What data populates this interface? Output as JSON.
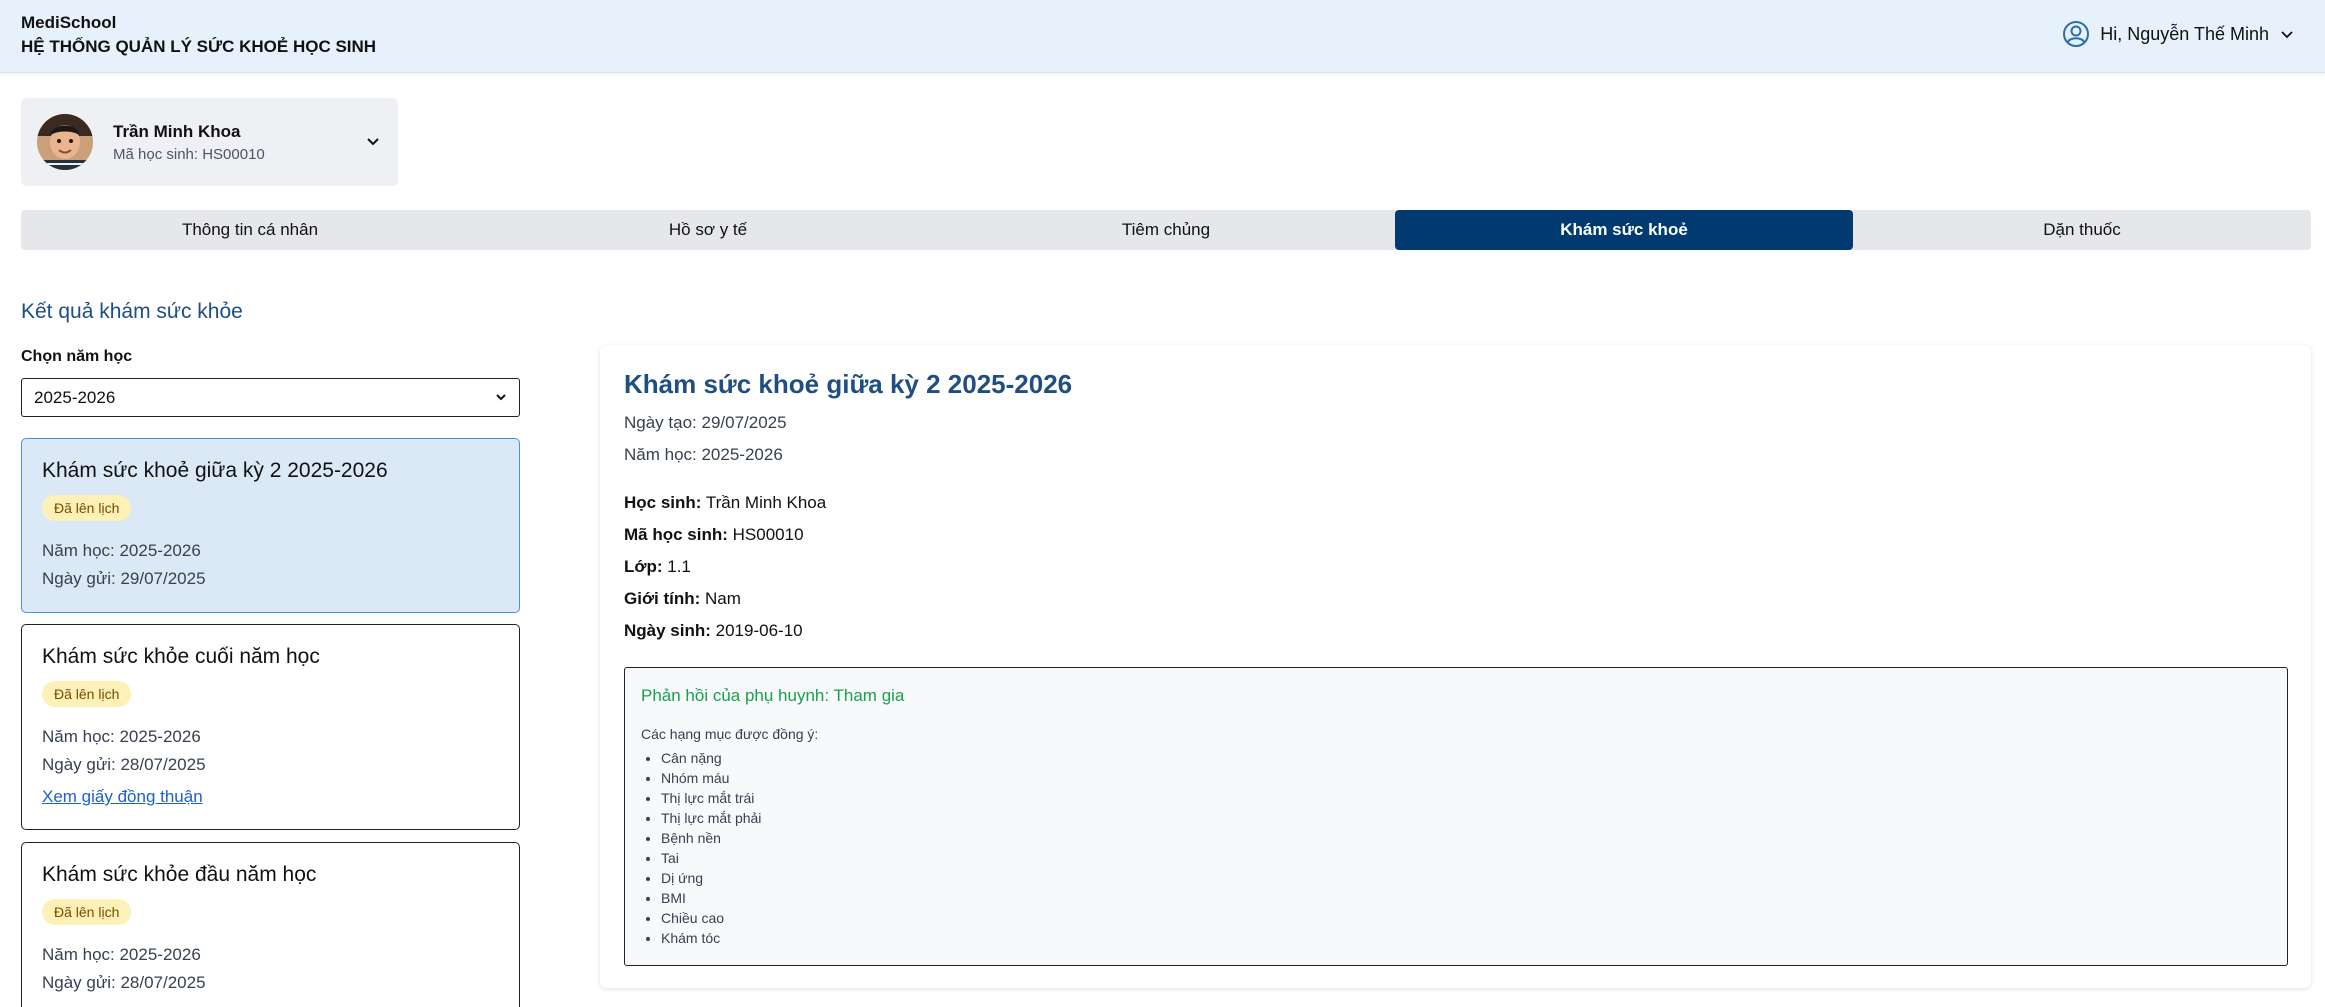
{
  "app": {
    "name": "MediSchool",
    "subtitle": "HỆ THỐNG QUẢN LÝ SỨC KHOẺ HỌC SINH",
    "user_greeting": "Hi, Nguyễn Thế Minh"
  },
  "student": {
    "name": "Trần Minh Khoa",
    "id_text": "Mã học sinh: HS00010"
  },
  "tabs": [
    {
      "label": "Thông tin cá nhân"
    },
    {
      "label": "Hồ sơ y tế"
    },
    {
      "label": "Tiêm chủng"
    },
    {
      "label": "Khám sức khoẻ",
      "active": true
    },
    {
      "label": "Dặn thuốc"
    }
  ],
  "results": {
    "section_title": "Kết quả khám sức khỏe",
    "year_label": "Chọn năm học",
    "year_selected": "2025-2026",
    "exams": [
      {
        "title": "Khám sức khoẻ giữa kỳ 2 2025-2026",
        "badge": "Đã lên lịch",
        "year": "Năm học: 2025-2026",
        "sent": "Ngày gửi: 29/07/2025"
      },
      {
        "title": "Khám sức khỏe cuối năm học",
        "badge": "Đã lên lịch",
        "year": "Năm học: 2025-2026",
        "sent": "Ngày gửi: 28/07/2025",
        "link": "Xem giấy đồng thuận"
      },
      {
        "title": "Khám sức khỏe đầu năm học",
        "badge": "Đã lên lịch",
        "year": "Năm học: 2025-2026",
        "sent": "Ngày gửi: 28/07/2025"
      }
    ]
  },
  "detail": {
    "title": "Khám sức khoẻ giữa kỳ 2 2025-2026",
    "created": "Ngày tạo: 29/07/2025",
    "year": "Năm học: 2025-2026",
    "student_label": "Học sinh:",
    "student_value": "Trần Minh Khoa",
    "id_label": "Mã học sinh:",
    "id_value": "HS00010",
    "class_label": "Lớp:",
    "class_value": "1.1",
    "gender_label": "Giới tính:",
    "gender_value": "Nam",
    "dob_label": "Ngày sinh:",
    "dob_value": "2019-06-10",
    "feedback_title": "Phản hồi của phụ huynh: Tham gia",
    "agreed_label": "Các hạng mục được đồng ý:",
    "agreed_items": [
      "Cân nặng",
      "Nhóm máu",
      "Thị lực mắt trái",
      "Thị lực mắt phải",
      "Bệnh nền",
      "Tai",
      "Dị ứng",
      "BMI",
      "Chiều cao",
      "Khám tóc"
    ]
  }
}
